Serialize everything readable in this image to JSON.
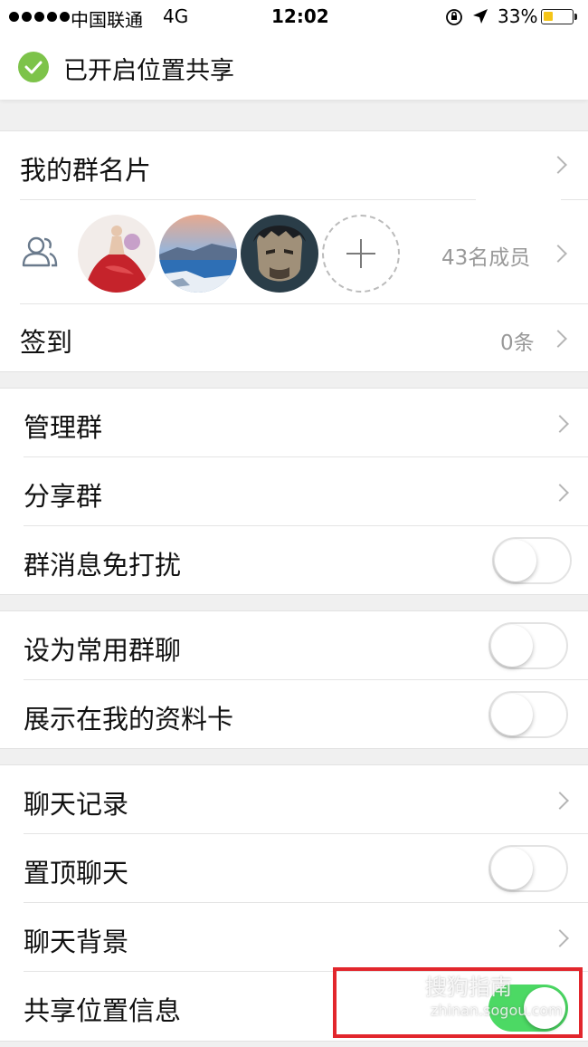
{
  "status_bar": {
    "carrier": "中国联通",
    "network": "4G",
    "time": "12:02",
    "battery": "33%",
    "battery_level": 0.33
  },
  "banner": {
    "text": "已开启位置共享"
  },
  "group_info": {
    "card_label": "我的群名片",
    "member_count": "43名成员",
    "checkin_label": "签到",
    "checkin_value": "0条"
  },
  "manage": {
    "manage_label": "管理群",
    "share_label": "分享群",
    "dnd_label": "群消息免打扰",
    "dnd_on": false
  },
  "display": {
    "favorite_label": "设为常用群聊",
    "favorite_on": false,
    "profile_card_label": "展示在我的资料卡",
    "profile_card_on": false
  },
  "chat": {
    "history_label": "聊天记录",
    "pin_label": "置顶聊天",
    "pin_on": false,
    "background_label": "聊天背景",
    "location_label": "共享位置信息",
    "location_on": true
  },
  "watermark": {
    "text": "搜狗指南",
    "sub": "zhinan.sogou.com"
  },
  "colors": {
    "toggle_on": "#4cd964",
    "check_green": "#7dc34a",
    "highlight_red": "#e2262c",
    "battery_yellow": "#f5c518"
  }
}
